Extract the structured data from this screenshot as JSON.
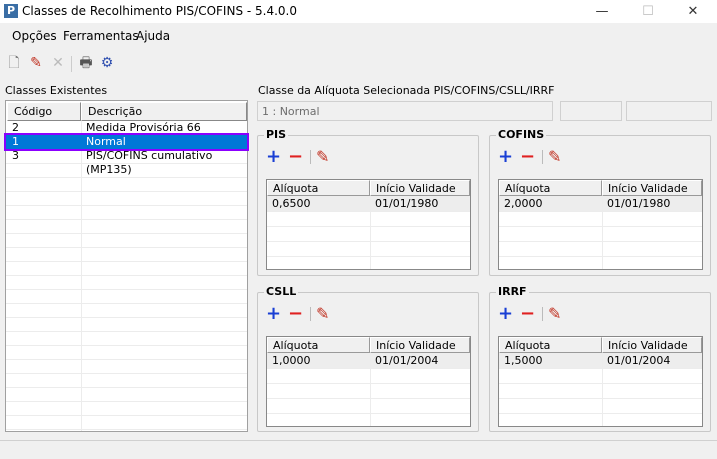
{
  "window": {
    "title": "Classes de Recolhimento PIS/COFINS - 5.4.0.0",
    "logo": "P",
    "minimize": "—",
    "maximize": "☐",
    "close": "✕"
  },
  "menu": [
    "Opções",
    "Ferramentas",
    "Ajuda"
  ],
  "toolbar": [
    {
      "icon": "new-document-icon",
      "glyph": "🗋"
    },
    {
      "icon": "edit-pencil-icon",
      "glyph": "✎"
    },
    {
      "icon": "delete-icon",
      "glyph": "✕"
    },
    {
      "icon": "printer-icon",
      "glyph": "🖶"
    },
    {
      "icon": "printer-settings-icon",
      "glyph": "⚙"
    }
  ],
  "classes": {
    "label": "Classes Existentes",
    "columns": [
      "Código",
      "Descrição"
    ],
    "rows": [
      {
        "codigo": "2",
        "descricao": "Medida Provisória 66"
      },
      {
        "codigo": "1",
        "descricao": "Normal",
        "selected": true
      },
      {
        "codigo": "3",
        "descricao": "PIS/COFINS cumulativo (MP135)"
      }
    ]
  },
  "selected": {
    "label": "Classe da Alíquota Selecionada PIS/COFINS/CSLL/IRRF",
    "value": "1 : Normal",
    "field2": "",
    "field3": ""
  },
  "groups": [
    {
      "title": "PIS",
      "columns": [
        "Alíquota",
        "Início Validade"
      ],
      "rows": [
        {
          "aliquota": "0,6500",
          "inicio": "01/01/1980"
        }
      ]
    },
    {
      "title": "COFINS",
      "columns": [
        "Alíquota",
        "Início Validade"
      ],
      "rows": [
        {
          "aliquota": "2,0000",
          "inicio": "01/01/1980"
        }
      ]
    },
    {
      "title": "CSLL",
      "columns": [
        "Alíquota",
        "Início Validade"
      ],
      "rows": [
        {
          "aliquota": "1,0000",
          "inicio": "01/01/2004"
        }
      ]
    },
    {
      "title": "IRRF",
      "columns": [
        "Alíquota",
        "Início Validade"
      ],
      "rows": [
        {
          "aliquota": "1,5000",
          "inicio": "01/01/2004"
        }
      ]
    }
  ],
  "icons": {
    "add": "+",
    "remove": "−",
    "edit": "✎"
  },
  "colors": {
    "selection": "#0078d7",
    "selection_border": "#8b00ff",
    "add": "#1a3fd4",
    "remove": "#e02020",
    "edit": "#c03020"
  }
}
